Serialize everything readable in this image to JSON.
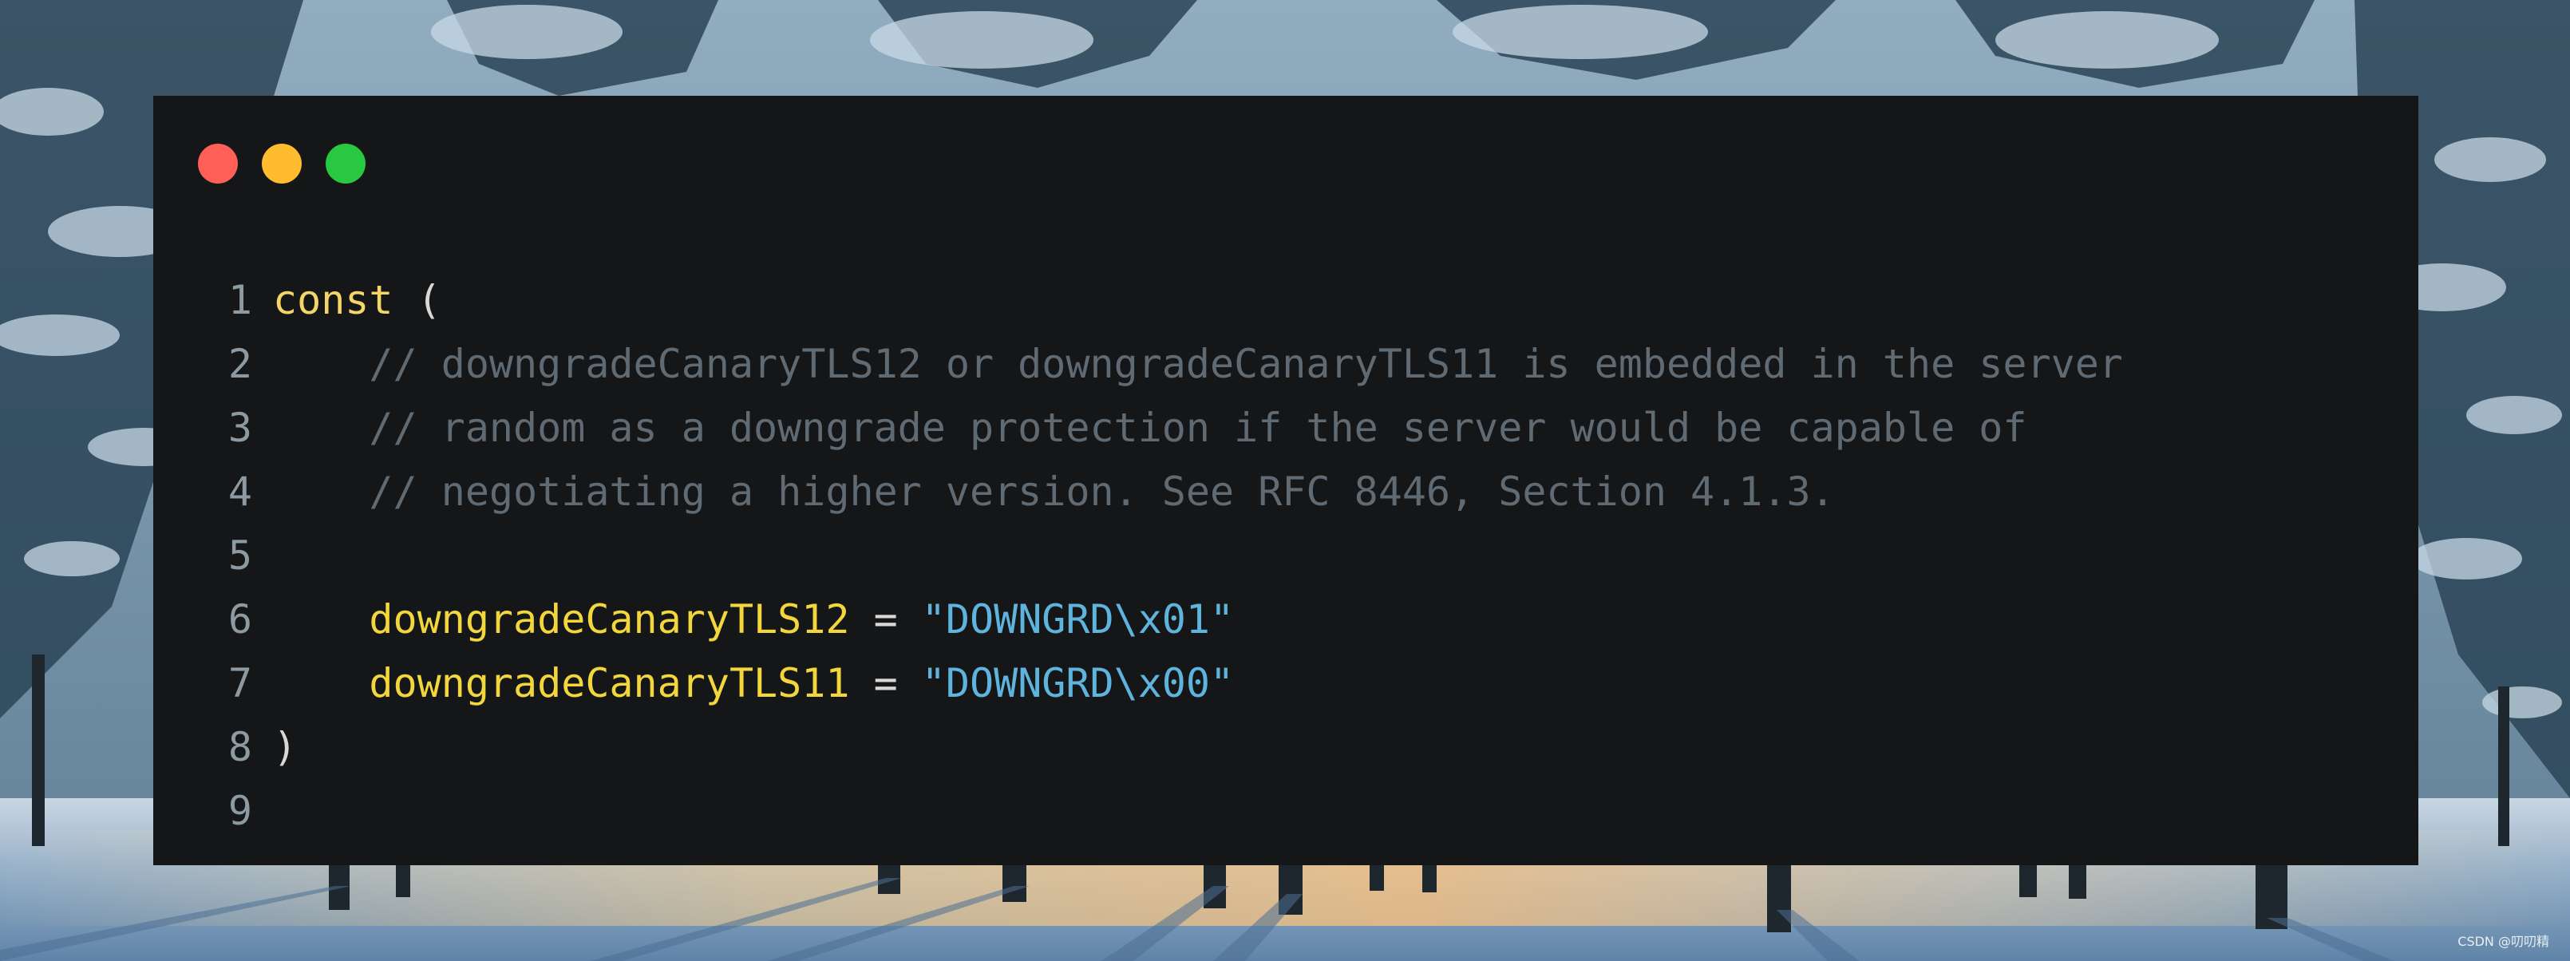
{
  "window": {
    "title": "",
    "traffic_lights": [
      {
        "name": "close",
        "color": "#fe5f57"
      },
      {
        "name": "minimize",
        "color": "#febc2e"
      },
      {
        "name": "zoom",
        "color": "#28c840"
      }
    ]
  },
  "code": {
    "language": "go",
    "lines": [
      {
        "number": "1",
        "tokens": [
          {
            "type": "kw",
            "text": "const"
          },
          {
            "type": "punc",
            "text": " ("
          }
        ]
      },
      {
        "number": "2",
        "tokens": [
          {
            "type": "comment",
            "text": "    // downgradeCanaryTLS12 or downgradeCanaryTLS11 is embedded in the server"
          }
        ]
      },
      {
        "number": "3",
        "tokens": [
          {
            "type": "comment",
            "text": "    // random as a downgrade protection if the server would be capable of"
          }
        ]
      },
      {
        "number": "4",
        "tokens": [
          {
            "type": "comment",
            "text": "    // negotiating a higher version. See RFC 8446, Section 4.1.3."
          }
        ]
      },
      {
        "number": "5",
        "tokens": []
      },
      {
        "number": "6",
        "tokens": [
          {
            "type": "ident",
            "text": "    downgradeCanaryTLS12"
          },
          {
            "type": "punc",
            "text": " = "
          },
          {
            "type": "str",
            "text": "\"DOWNGRD\\x01\""
          }
        ]
      },
      {
        "number": "7",
        "tokens": [
          {
            "type": "ident",
            "text": "    downgradeCanaryTLS11"
          },
          {
            "type": "punc",
            "text": " = "
          },
          {
            "type": "str",
            "text": "\"DOWNGRD\\x00\""
          }
        ]
      },
      {
        "number": "8",
        "tokens": [
          {
            "type": "punc",
            "text": ")"
          }
        ]
      },
      {
        "number": "9",
        "tokens": []
      }
    ],
    "colors": {
      "background": "#151618",
      "line_number": "#8d9aa2",
      "keyword": "#f5d565",
      "comment": "#5f6a73",
      "identifier": "#f2d63b",
      "string": "#5fb4dd"
    }
  },
  "background": {
    "watermark": "CSDN @叨叨精"
  }
}
